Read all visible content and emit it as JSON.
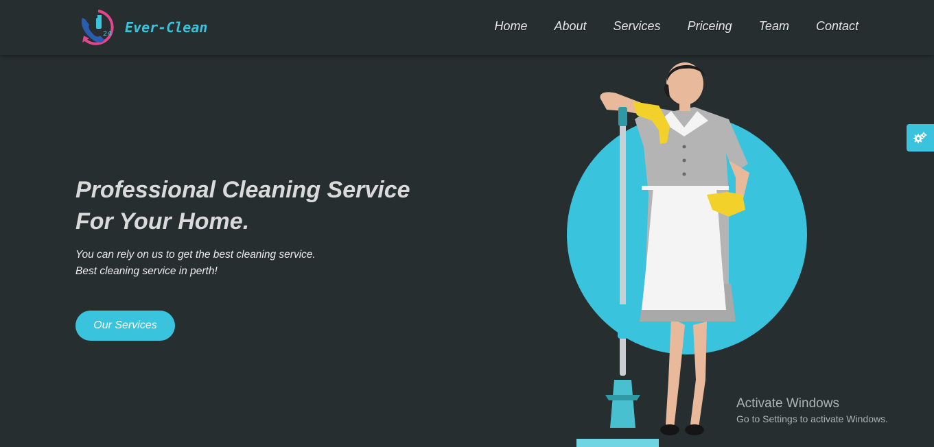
{
  "brand": {
    "name": "Ever-Clean",
    "badge": "24",
    "accent_color": "#3ac3dc",
    "pink_color": "#e0488c",
    "background_color": "#262e30"
  },
  "nav": {
    "items": [
      {
        "label": "Home"
      },
      {
        "label": "About"
      },
      {
        "label": "Services"
      },
      {
        "label": "Priceing"
      },
      {
        "label": "Team"
      },
      {
        "label": "Contact"
      }
    ]
  },
  "hero": {
    "title_line1": "Professional Cleaning Service",
    "title_line2": "For Your Home.",
    "subtitle_line1": "You can rely on us to get the best cleaning service.",
    "subtitle_line2": "Best cleaning service in perth!",
    "cta_label": "Our Services",
    "image_icon": "cleaning-woman-with-mop-illustration"
  },
  "settings": {
    "icon": "gears-icon"
  },
  "watermark": {
    "line1": "Activate Windows",
    "line2": "Go to Settings to activate Windows."
  }
}
